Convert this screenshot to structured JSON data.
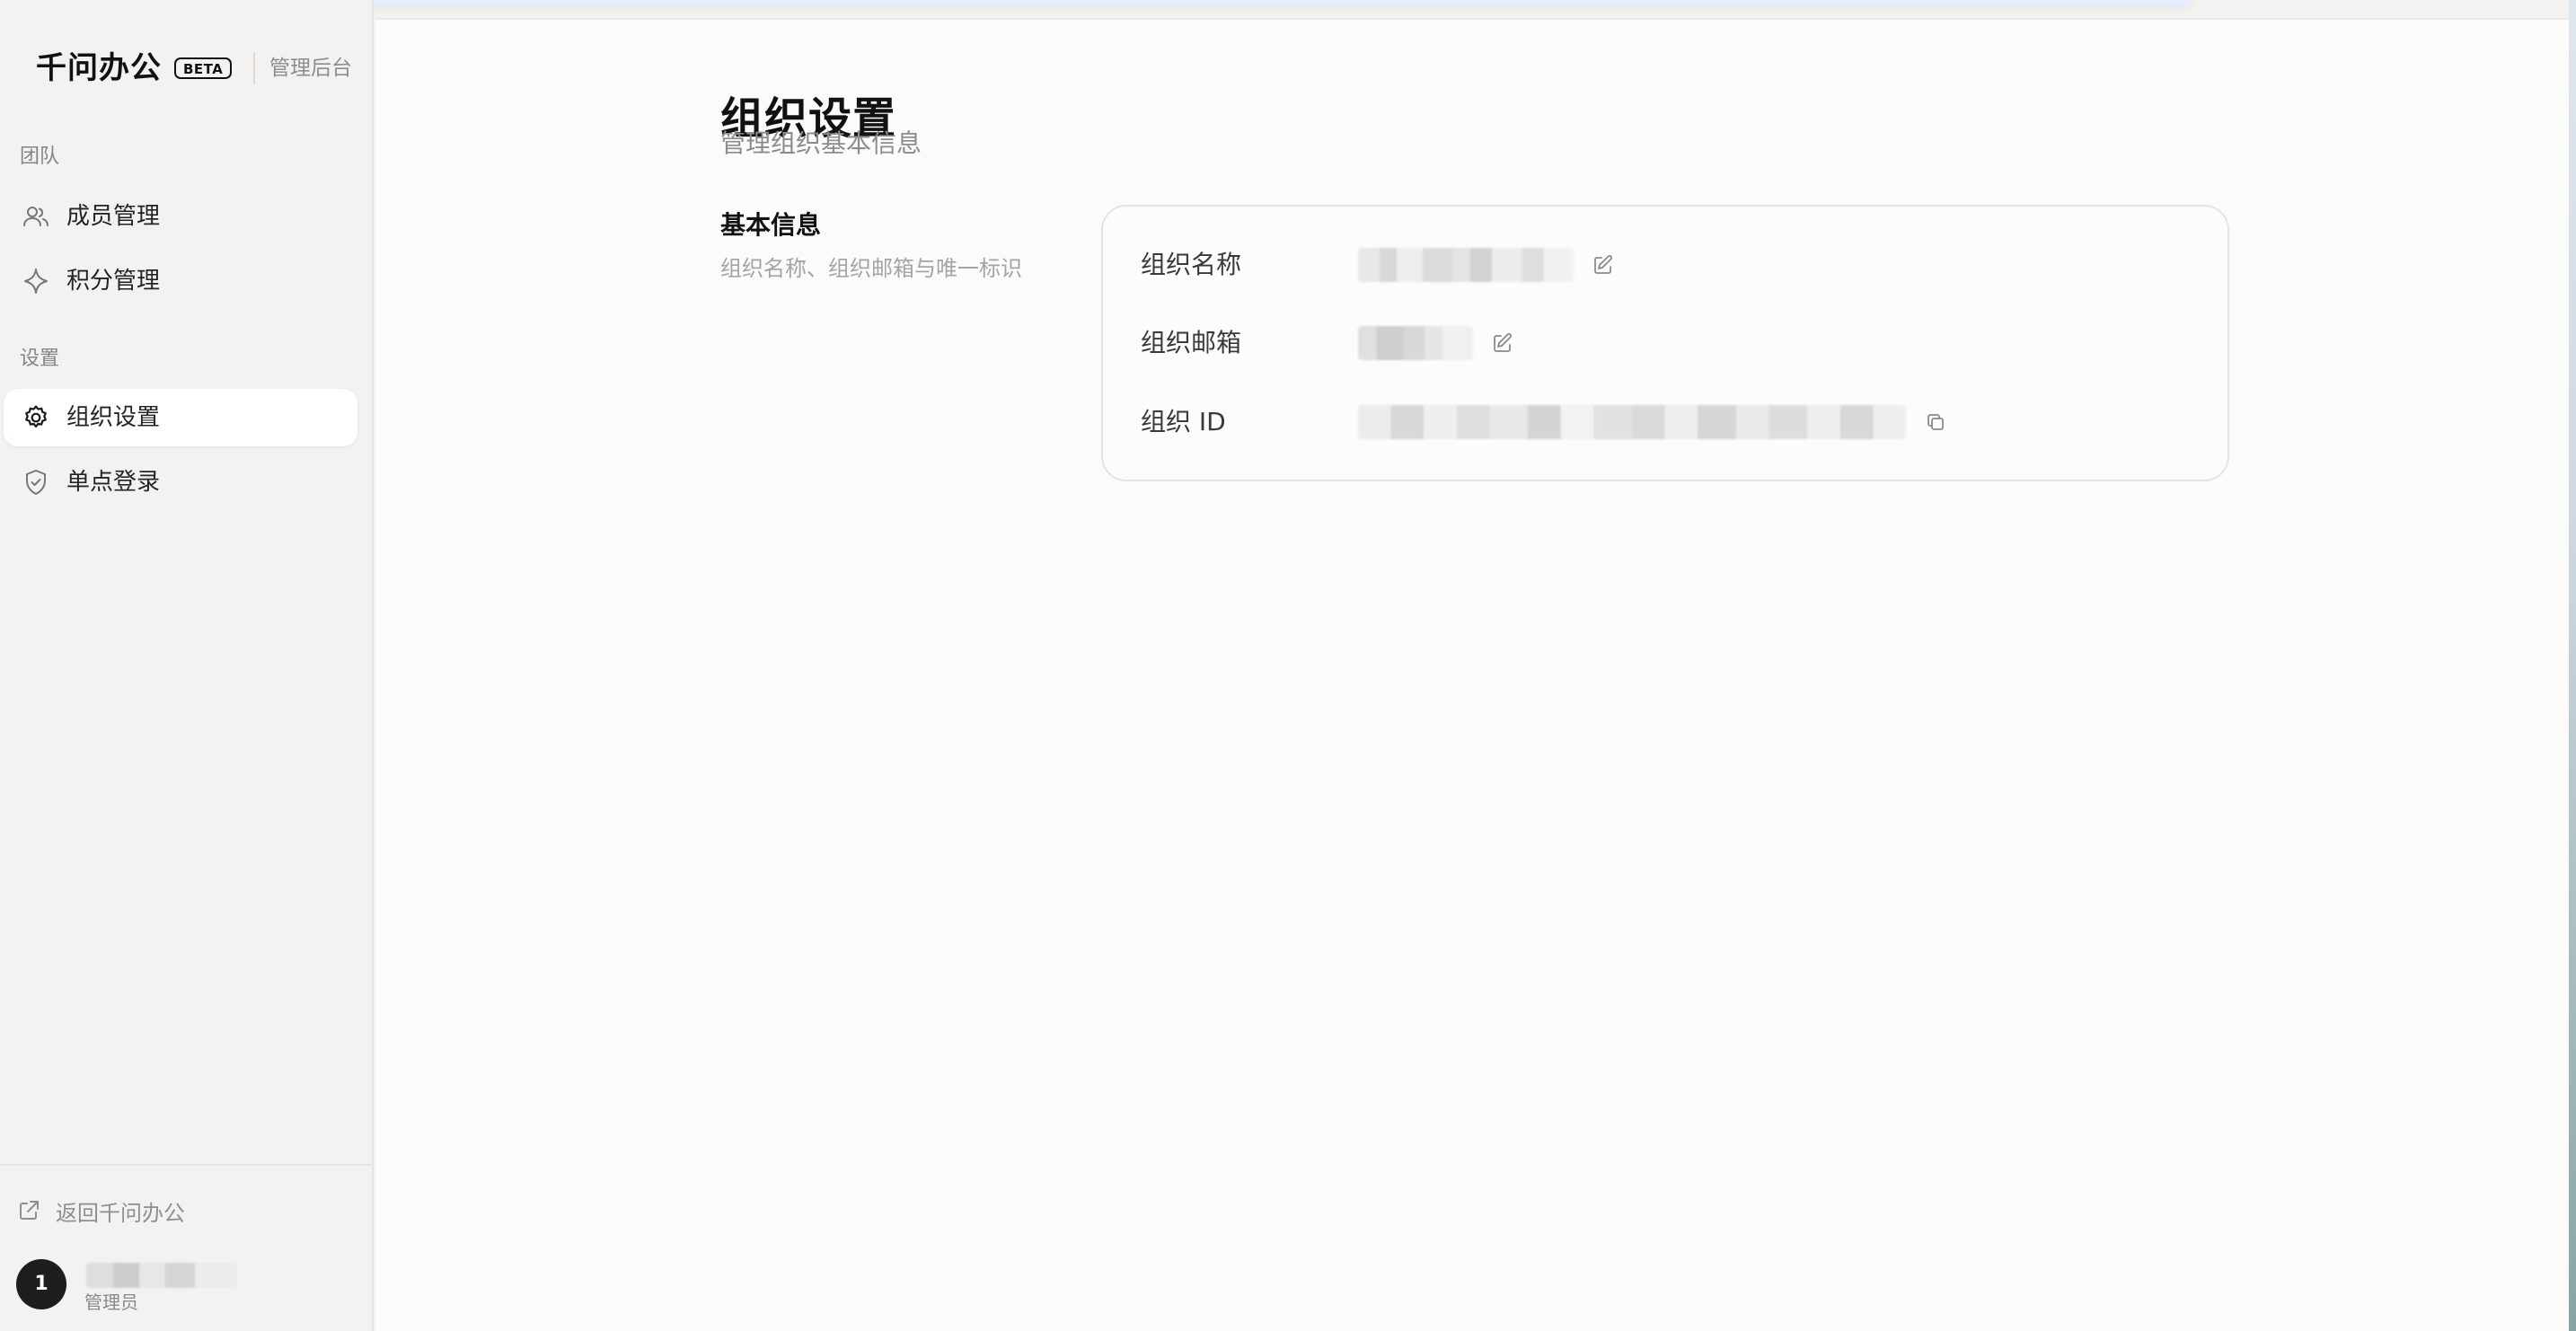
{
  "brand": {
    "name": "千问办公",
    "badge": "BETA",
    "admin_label": "管理后台"
  },
  "sidebar": {
    "sections": [
      {
        "label": "团队",
        "items": [
          {
            "label": "成员管理",
            "icon": "users-icon",
            "active": false
          },
          {
            "label": "积分管理",
            "icon": "sparkle-icon",
            "active": false
          }
        ]
      },
      {
        "label": "设置",
        "items": [
          {
            "label": "组织设置",
            "icon": "gear-icon",
            "active": true
          },
          {
            "label": "单点登录",
            "icon": "shield-check-icon",
            "active": false
          }
        ]
      }
    ],
    "footer": {
      "back_label": "返回千问办公",
      "user": {
        "avatar_text": "1",
        "role": "管理员"
      }
    }
  },
  "page": {
    "title": "组织设置",
    "subtitle": "管理组织基本信息",
    "section_title": "基本信息",
    "section_desc": "组织名称、组织邮箱与唯一标识"
  },
  "info_card": {
    "rows": [
      {
        "label": "组织名称",
        "action_icon": "edit-icon"
      },
      {
        "label": "组织邮箱",
        "action_icon": "edit-icon"
      },
      {
        "label": "组织 ID",
        "action_icon": "copy-icon"
      }
    ]
  },
  "colors": {
    "sidebar_bg": "#f3f2f0",
    "main_bg": "#fbfbf9",
    "active_bg": "#ffffff",
    "text_primary": "#111111",
    "text_secondary": "#8c8c8c"
  }
}
